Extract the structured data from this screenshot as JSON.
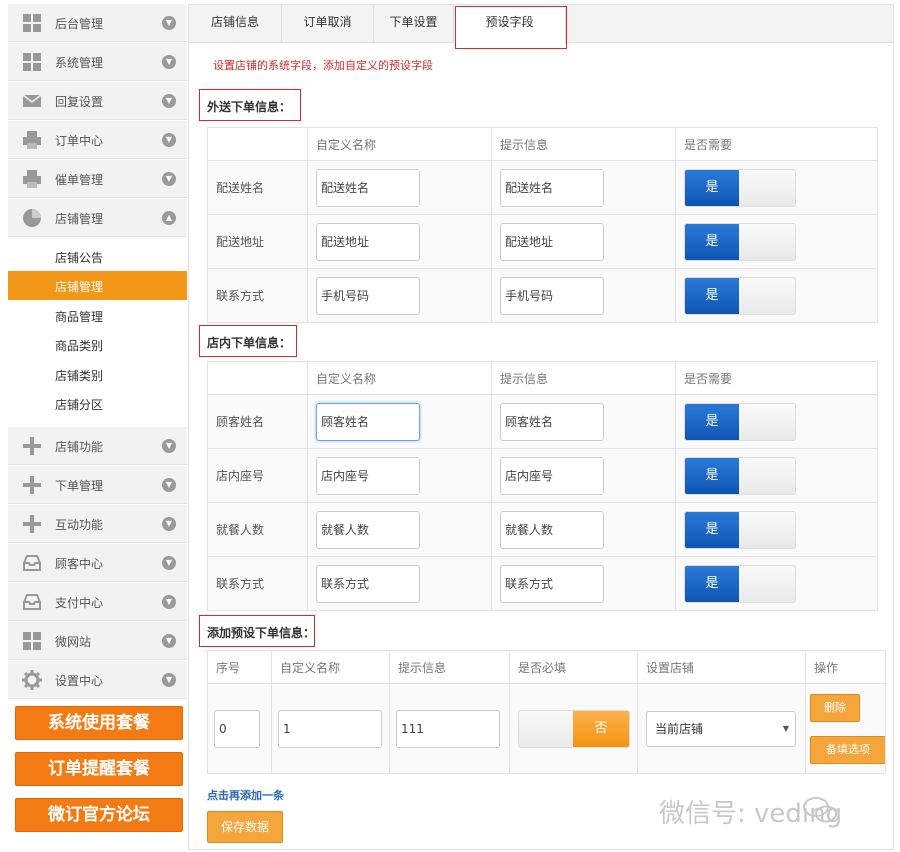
{
  "sidebar": {
    "items": [
      {
        "label": "后台管理",
        "icon": "grid-icon"
      },
      {
        "label": "系统管理",
        "icon": "grid-icon"
      },
      {
        "label": "回复设置",
        "icon": "mail-icon"
      },
      {
        "label": "订单中心",
        "icon": "printer-icon"
      },
      {
        "label": "催单管理",
        "icon": "printer-icon"
      },
      {
        "label": "店铺管理",
        "icon": "pie-icon"
      }
    ],
    "sub_items": [
      {
        "label": "店铺公告"
      },
      {
        "label": "店铺管理"
      },
      {
        "label": "商品管理"
      },
      {
        "label": "商品类别"
      },
      {
        "label": "店铺类别"
      },
      {
        "label": "店铺分区"
      }
    ],
    "items2": [
      {
        "label": "店铺功能",
        "icon": "plus-icon"
      },
      {
        "label": "下单管理",
        "icon": "plus-icon"
      },
      {
        "label": "互动功能",
        "icon": "plus-icon"
      },
      {
        "label": "顾客中心",
        "icon": "tray-icon"
      },
      {
        "label": "支付中心",
        "icon": "tray-icon"
      },
      {
        "label": "微网站",
        "icon": "grid-icon"
      },
      {
        "label": "设置中心",
        "icon": "gear-icon"
      }
    ],
    "promos": [
      "系统使用套餐",
      "订单提醒套餐",
      "微订官方论坛"
    ]
  },
  "tabs": [
    "店铺信息",
    "订单取消",
    "下单设置",
    "预设字段"
  ],
  "description": "设置店铺的系统字段，添加自定义的预设字段",
  "section1": {
    "title": "外送下单信息：",
    "headers": [
      "",
      "自定义名称",
      "提示信息",
      "是否需要"
    ],
    "rows": [
      {
        "label": "配送姓名",
        "name": "配送姓名",
        "hint": "配送姓名",
        "toggle": "是"
      },
      {
        "label": "配送地址",
        "name": "配送地址",
        "hint": "配送地址",
        "toggle": "是"
      },
      {
        "label": "联系方式",
        "name": "手机号码",
        "hint": "手机号码",
        "toggle": "是"
      }
    ]
  },
  "section2": {
    "title": "店内下单信息：",
    "headers": [
      "",
      "自定义名称",
      "提示信息",
      "是否需要"
    ],
    "rows": [
      {
        "label": "顾客姓名",
        "name": "顾客姓名",
        "hint": "顾客姓名",
        "toggle": "是"
      },
      {
        "label": "店内座号",
        "name": "店内座号",
        "hint": "店内座号",
        "toggle": "是"
      },
      {
        "label": "就餐人数",
        "name": "就餐人数",
        "hint": "就餐人数",
        "toggle": "是"
      },
      {
        "label": "联系方式",
        "name": "联系方式",
        "hint": "联系方式",
        "toggle": "是"
      }
    ]
  },
  "section3": {
    "title": "添加预设下单信息：",
    "headers": [
      "序号",
      "自定义名称",
      "提示信息",
      "是否必填",
      "设置店铺",
      "操作"
    ],
    "row": {
      "index": "0",
      "name": "1",
      "hint": "111",
      "toggle": "否",
      "store": "当前店铺",
      "delete": "删除",
      "options": "备填选项"
    }
  },
  "add_link": "点击再添加一条",
  "save_button": "保存数据",
  "watermark": "微信号: veding",
  "colors": {
    "accent": "#f29718",
    "toggle_on": "#1565c0",
    "highlight": "#d52b2b"
  }
}
